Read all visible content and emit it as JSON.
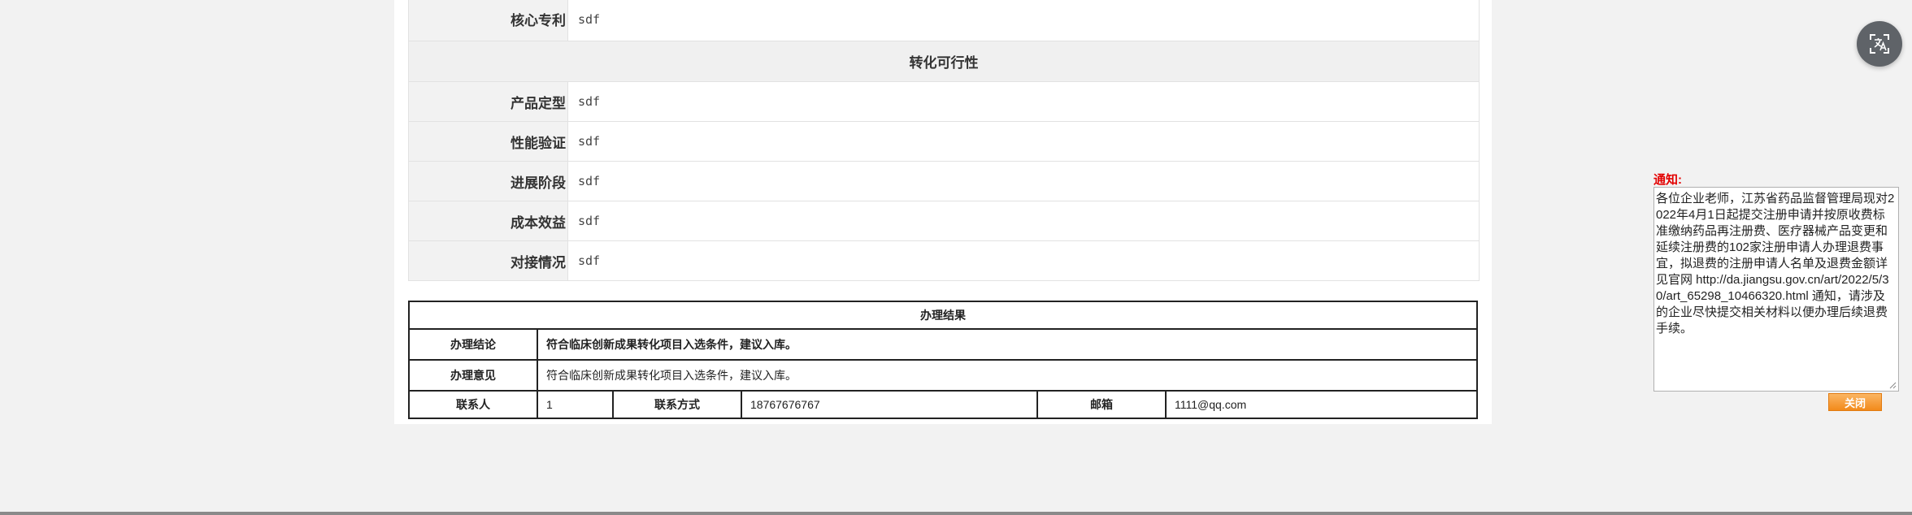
{
  "detail": {
    "first_row": {
      "label": "核心专利",
      "value": "sdf"
    },
    "section_title": "转化可行性",
    "rows": [
      {
        "label": "产品定型",
        "value": "sdf"
      },
      {
        "label": "性能验证",
        "value": "sdf"
      },
      {
        "label": "进展阶段",
        "value": "sdf"
      },
      {
        "label": "成本效益",
        "value": "sdf"
      },
      {
        "label": "对接情况",
        "value": "sdf"
      }
    ]
  },
  "result": {
    "title": "办理结果",
    "conclusion_label": "办理结论",
    "conclusion_value": "符合临床创新成果转化项目入选条件，建议入库。",
    "opinion_label": "办理意见",
    "opinion_value": "符合临床创新成果转化项目入选条件，建议入库。",
    "contact_label": "联系人",
    "contact_value": "1",
    "phone_label": "联系方式",
    "phone_value": "18767676767",
    "email_label": "邮箱",
    "email_value": "1111@qq.com"
  },
  "notice": {
    "title": "通知:",
    "text": "各位企业老师，江苏省药品监督管理局现对2022年4月1日起提交注册申请并按原收费标准缴纳药品再注册费、医疗器械产品变更和延续注册费的102家注册申请人办理退费事宜，拟退费的注册申请人名单及退费金额详见官网 http://da.jiangsu.gov.cn/art/2022/5/30/art_65298_10466320.html 通知，请涉及的企业尽快提交相关材料以便办理后续退费手续。",
    "close_label": "关闭"
  },
  "icons": {
    "translate": "translate-icon"
  },
  "colors": {
    "notice_title": "#e30000",
    "close_button": "#f28a1b"
  }
}
